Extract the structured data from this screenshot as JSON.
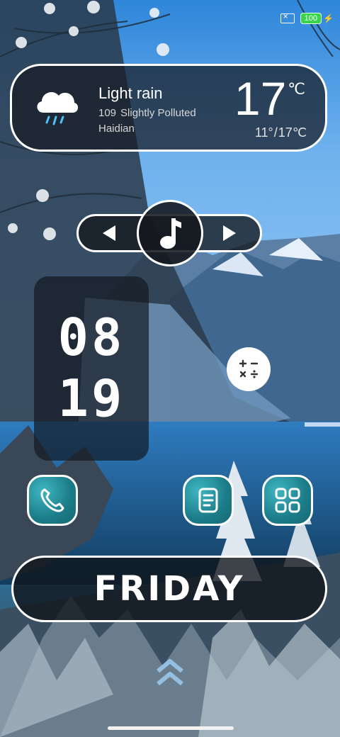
{
  "status": {
    "battery": "100"
  },
  "weather": {
    "condition": "Light rain",
    "aqi_value": "109",
    "aqi_label": "Slightly Polluted",
    "location": "Haidian",
    "temperature": "17",
    "unit": "℃",
    "low": "11°",
    "separator": "/",
    "high": "17℃",
    "icon": "rain-cloud-icon"
  },
  "clock": {
    "hour": "08",
    "minute": "19"
  },
  "day": {
    "name": "FRIDAY"
  },
  "apps": [
    {
      "name": "Phone",
      "icon": "phone-icon"
    },
    {
      "name": "Notes",
      "icon": "notes-icon"
    },
    {
      "name": "Launcher",
      "icon": "grid-icon"
    }
  ],
  "colors": {
    "accent": "#2a9aa8",
    "battery": "#38d44a"
  }
}
